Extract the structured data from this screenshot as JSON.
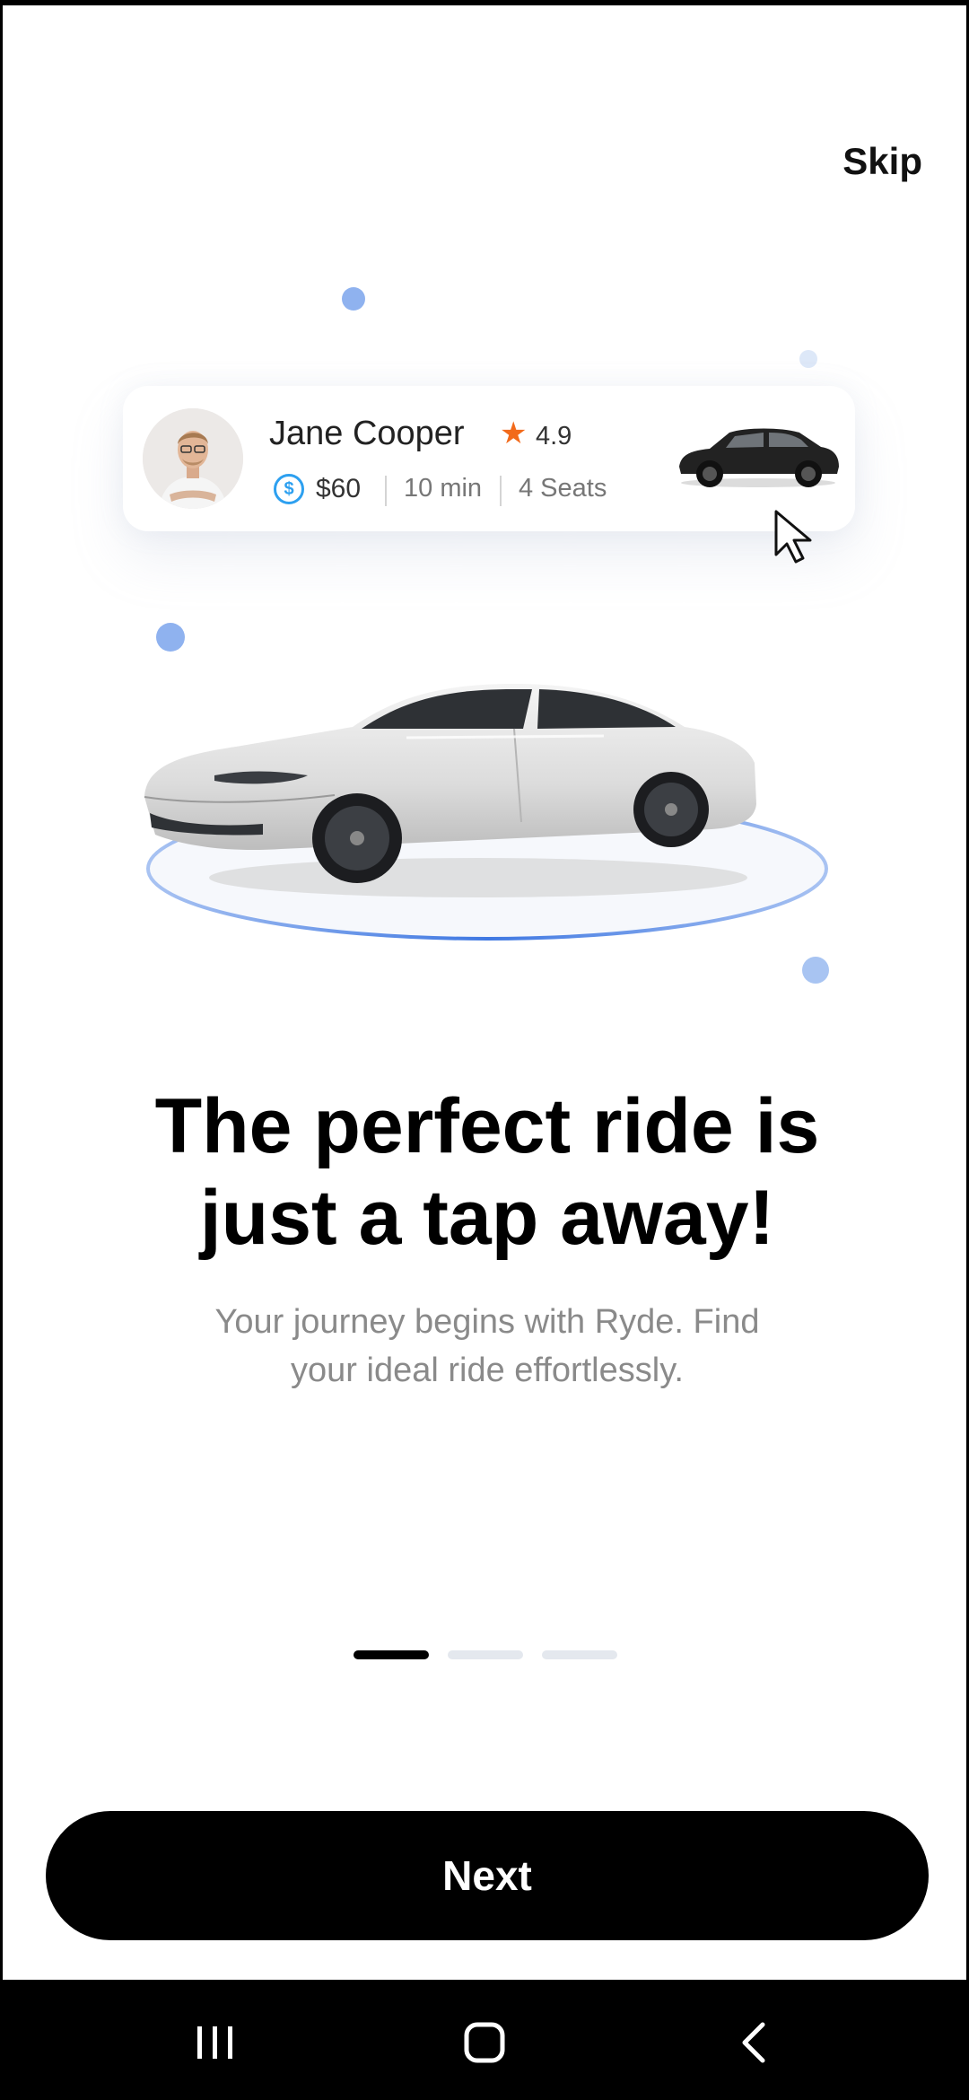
{
  "header": {
    "skip_label": "Skip"
  },
  "driver_card": {
    "name": "Jane Cooper",
    "rating": "4.9",
    "price": "$60",
    "eta": "10 min",
    "seats": "4 Seats",
    "icons": {
      "rating": "star-icon",
      "price": "dollar-coin-icon",
      "avatar": "driver-avatar",
      "vehicle": "car-thumbnail"
    },
    "colors": {
      "star": "#f26a1b",
      "coin": "#2da0f0"
    }
  },
  "hero": {
    "image": "white-sedan-on-platform",
    "platform_color": "#4f86e8"
  },
  "onboarding": {
    "title_line1": "The perfect ride is",
    "title_line2": "just a tap away!",
    "subtitle_line1": "Your journey begins with Ryde. Find",
    "subtitle_line2": "your ideal ride effortlessly.",
    "page_indicator": {
      "current": 1,
      "total": 3
    }
  },
  "actions": {
    "next_label": "Next"
  },
  "system_nav": {
    "icons": [
      "recent-apps-icon",
      "home-icon",
      "back-icon"
    ]
  }
}
